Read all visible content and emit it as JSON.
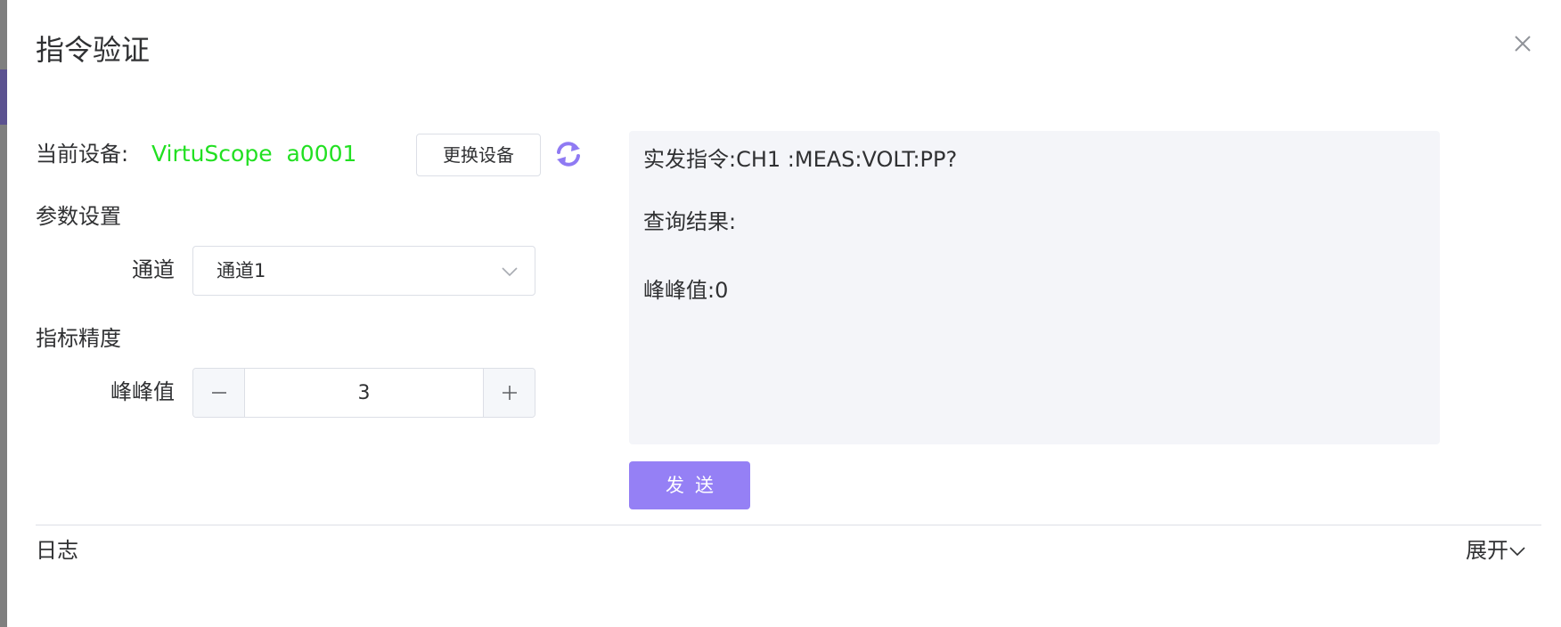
{
  "dialog": {
    "title": "指令验证",
    "close_icon": "close-icon"
  },
  "device": {
    "label": "当前设备:",
    "name": "VirtuScope  a0001",
    "name_color": "#22e022",
    "change_button": "更换设备",
    "refresh_icon": "refresh-icon"
  },
  "params": {
    "section_title": "参数设置",
    "channel_label": "通道",
    "channel_value": "通道1"
  },
  "precision": {
    "section_title": "指标精度",
    "peak_label": "峰峰值",
    "peak_value": "3",
    "minus_icon": "minus-icon",
    "plus_icon": "plus-icon"
  },
  "output": {
    "command_line": "实发指令:CH1 :MEAS:VOLT:PP?",
    "result_line": "查询结果:",
    "value_line": "峰峰值:0",
    "background": "#f4f5f9"
  },
  "send_button": "发送",
  "accent_color": "#9580f5",
  "log": {
    "label": "日志",
    "expand": "展开"
  }
}
